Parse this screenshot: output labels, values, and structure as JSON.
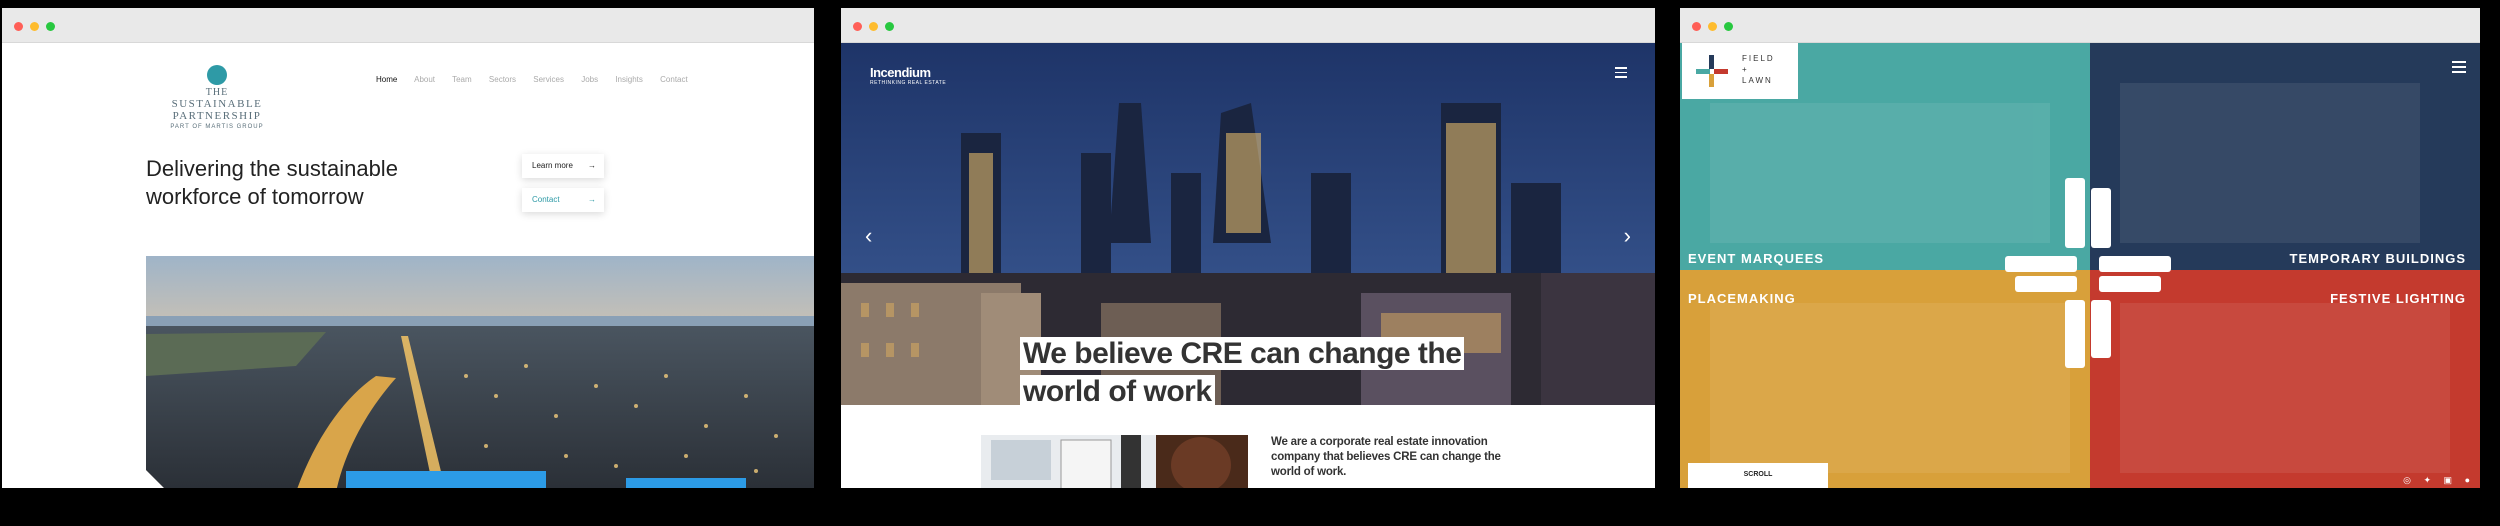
{
  "window1": {
    "logo": {
      "line1": "THE",
      "line2": "SUSTAINABLE PARTNERSHIP",
      "line3": "PART OF MARTIS GROUP"
    },
    "nav": [
      "Home",
      "About",
      "Team",
      "Sectors",
      "Services",
      "Jobs",
      "Insights",
      "Contact"
    ],
    "headline": "Delivering the sustainable workforce of tomorrow",
    "buttons": {
      "learn_more": "Learn more",
      "contact": "Contact",
      "arrow": "→"
    },
    "colors": {
      "accent": "#2e9aa6"
    }
  },
  "window2": {
    "brand": {
      "name": "Incendium",
      "tagline": "RETHINKING REAL ESTATE"
    },
    "headline": {
      "line1": "We believe CRE can change the",
      "line2": "world of work"
    },
    "body": "We are a corporate real estate innovation company that believes CRE can change the world of work.",
    "arrows": {
      "prev": "‹",
      "next": "›"
    }
  },
  "window3": {
    "logo": {
      "line1": "FIELD",
      "line2": "+",
      "line3": "LAWN"
    },
    "labels": {
      "top_left": "EVENT MARQUEES",
      "top_right": "TEMPORARY BUILDINGS",
      "bottom_left": "PLACEMAKING",
      "bottom_right": "FESTIVE LIGHTING"
    },
    "scroll": "SCROLL",
    "social_icons": [
      "instagram-icon",
      "twitter-icon",
      "linkedin-icon",
      "facebook-icon"
    ],
    "colors": {
      "teal": "#4aa8a3",
      "navy": "#253a5a",
      "amber": "#d8a03a",
      "red": "#c43a2e"
    }
  }
}
